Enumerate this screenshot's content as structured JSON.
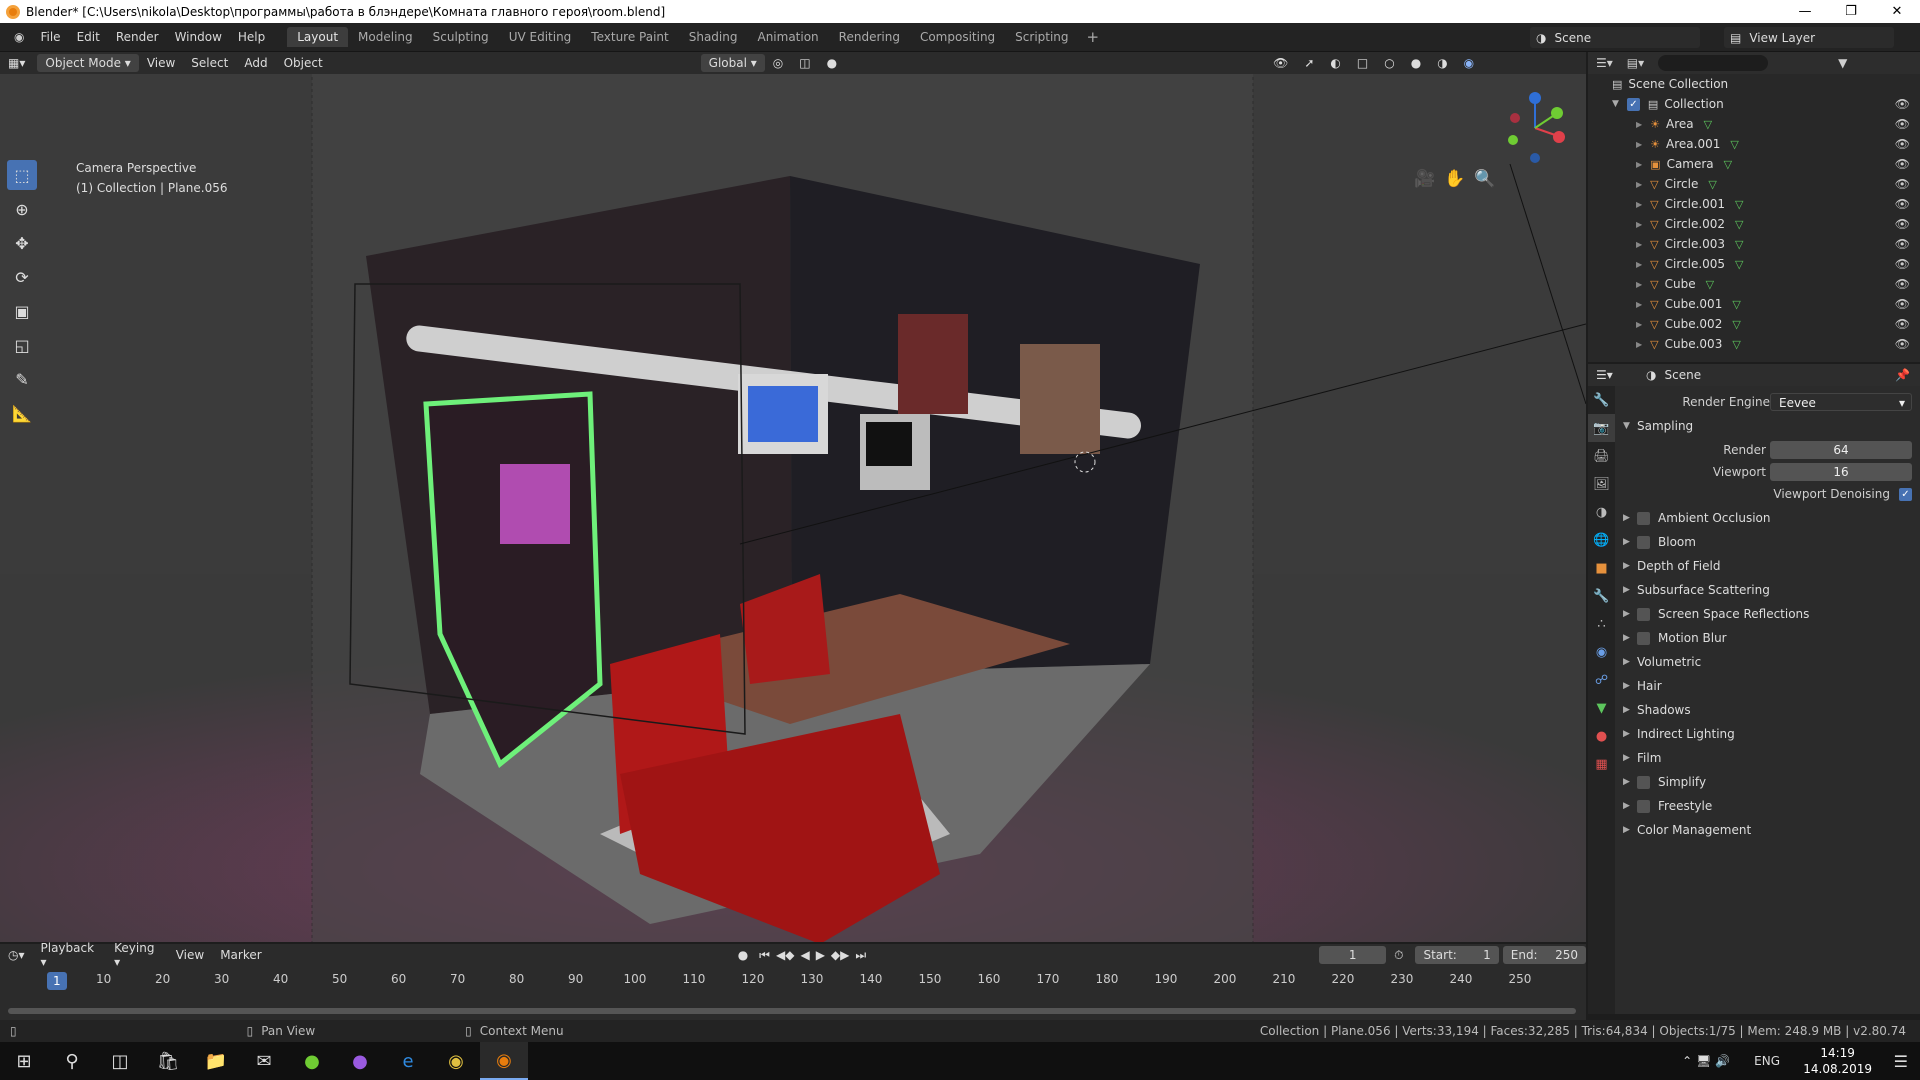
{
  "window": {
    "title": "Blender* [C:\\Users\\nikola\\Desktop\\программы\\работа в блэндере\\Комната главного героя\\room.blend]"
  },
  "menu": [
    "File",
    "Edit",
    "Render",
    "Window",
    "Help"
  ],
  "workspaces": [
    "Layout",
    "Modeling",
    "Sculpting",
    "UV Editing",
    "Texture Paint",
    "Shading",
    "Animation",
    "Rendering",
    "Compositing",
    "Scripting"
  ],
  "scene": {
    "name": "Scene",
    "view_layer": "View Layer"
  },
  "viewport_header": {
    "mode": "Object Mode",
    "menus": [
      "View",
      "Select",
      "Add",
      "Object"
    ],
    "orientation": "Global"
  },
  "viewport": {
    "perspective": "Camera Perspective",
    "collection_info": "(1) Collection | Plane.056"
  },
  "outliner": {
    "root": "Scene Collection",
    "collection": "Collection",
    "items": [
      "Area",
      "Area.001",
      "Camera",
      "Circle",
      "Circle.001",
      "Circle.002",
      "Circle.003",
      "Circle.005",
      "Cube",
      "Cube.001",
      "Cube.002",
      "Cube.003"
    ]
  },
  "properties": {
    "title": "Scene",
    "render_engine_label": "Render Engine",
    "render_engine": "Eevee",
    "sampling": {
      "label": "Sampling",
      "render_label": "Render",
      "render": "64",
      "viewport_label": "Viewport",
      "viewport": "16",
      "denoise": "Viewport Denoising"
    },
    "panels": [
      {
        "label": "Ambient Occlusion",
        "check": true
      },
      {
        "label": "Bloom",
        "check": true
      },
      {
        "label": "Depth of Field",
        "check": false
      },
      {
        "label": "Subsurface Scattering",
        "check": false
      },
      {
        "label": "Screen Space Reflections",
        "check": true
      },
      {
        "label": "Motion Blur",
        "check": true
      },
      {
        "label": "Volumetric",
        "check": false
      },
      {
        "label": "Hair",
        "check": false
      },
      {
        "label": "Shadows",
        "check": false
      },
      {
        "label": "Indirect Lighting",
        "check": false
      },
      {
        "label": "Film",
        "check": false
      },
      {
        "label": "Simplify",
        "check": true
      },
      {
        "label": "Freestyle",
        "check": true
      },
      {
        "label": "Color Management",
        "check": false
      }
    ]
  },
  "timeline": {
    "menus": [
      "Playback",
      "Keying",
      "View",
      "Marker"
    ],
    "current": "1",
    "start_label": "Start:",
    "start": "1",
    "end_label": "End:",
    "end": "250",
    "ticks": [
      "10",
      "20",
      "30",
      "40",
      "50",
      "60",
      "70",
      "80",
      "90",
      "100",
      "110",
      "120",
      "130",
      "140",
      "150",
      "160",
      "170",
      "180",
      "190",
      "200",
      "210",
      "220",
      "230",
      "240",
      "250"
    ]
  },
  "status": {
    "pan": "Pan View",
    "context": "Context Menu",
    "stats": "Collection | Plane.056 | Verts:33,194 | Faces:32,285 | Tris:64,834 | Objects:1/75 | Mem: 248.9 MB | v2.80.74"
  },
  "taskbar": {
    "lang": "ENG",
    "time": "14:19",
    "date": "14.08.2019"
  }
}
